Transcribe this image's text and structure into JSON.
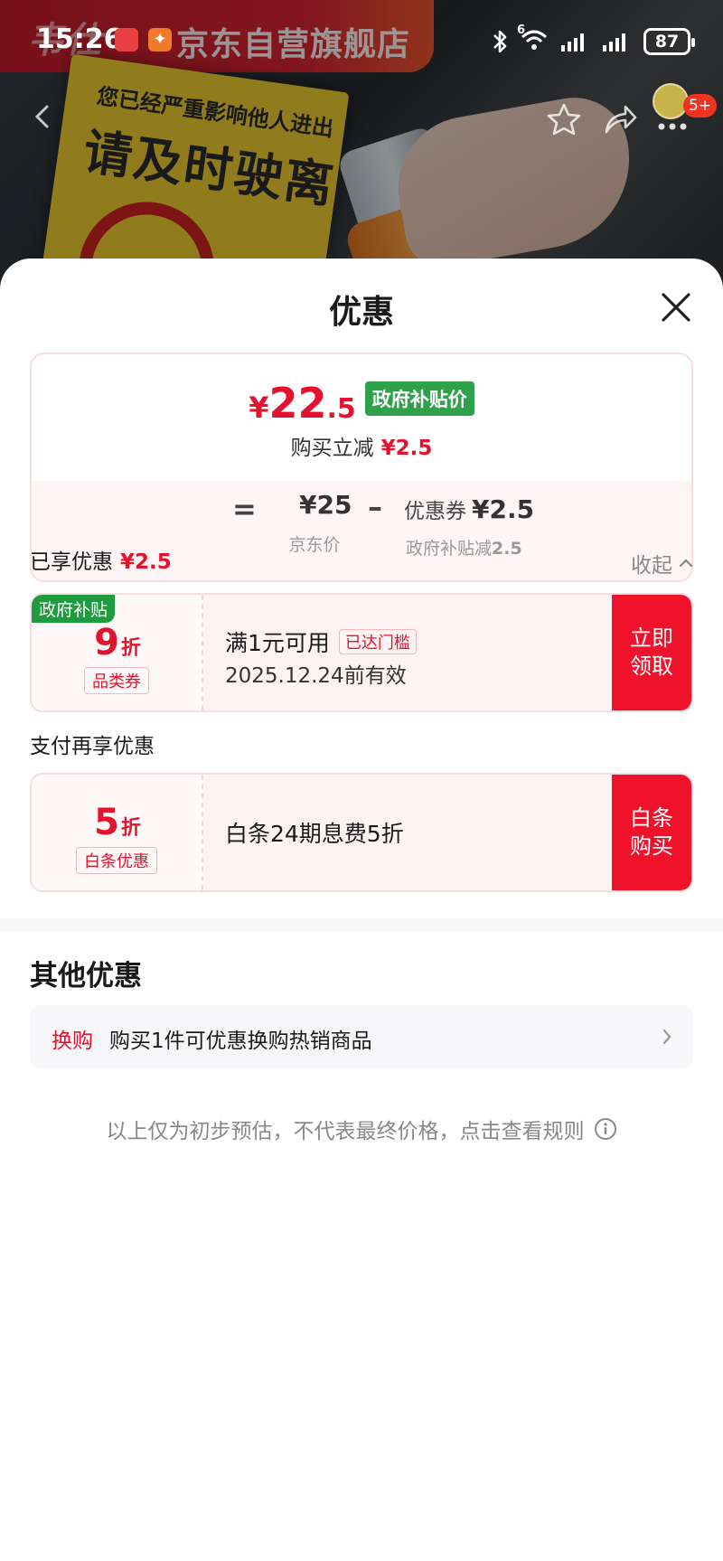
{
  "status_bar": {
    "time": "15:26",
    "battery": "87",
    "network": "6"
  },
  "hero": {
    "brand_logo_text": "韦仕",
    "shop_name": "京东自营旗舰店",
    "poster_line1": "您已经严重影响他人进出",
    "poster_line2": "请及时驶离",
    "message_badge": "5+"
  },
  "sheet": {
    "title": "优惠",
    "price_summary": {
      "currency": "¥",
      "final_int": "22",
      "final_dec": ".5",
      "gov_tag": "政府补贴价",
      "reduce_label": "购买立减",
      "reduce_amount": "¥2.5",
      "eq": "=",
      "jd_price": "¥25",
      "jd_label": "京东价",
      "minus": "–",
      "coupon_label": "优惠券",
      "coupon_value": "¥2.5",
      "coupon_sub_label": "政府补贴减",
      "coupon_sub_value": "2.5"
    },
    "enjoyed": {
      "label": "已享优惠",
      "amount": "¥2.5",
      "collapse_label": "收起"
    },
    "coupon1": {
      "corner_tag": "政府补贴",
      "discount_num": "9",
      "discount_unit": "折",
      "kind": "品类券",
      "condition": "满1元可用",
      "reached": "已达门槛",
      "expire": "2025.12.24前有效",
      "cta_line1": "立即",
      "cta_line2": "领取"
    },
    "pay_title": "支付再享优惠",
    "coupon2": {
      "discount_num": "5",
      "discount_unit": "折",
      "kind": "白条优惠",
      "desc": "白条24期息费5折",
      "cta_line1": "白条",
      "cta_line2": "购买"
    },
    "other": {
      "title": "其他优惠",
      "swap_tag": "换购",
      "swap_text": "购买1件可优惠换购热销商品"
    },
    "disclaimer": "以上仅为初步预估，不代表最终价格，点击查看规则"
  },
  "colors": {
    "accent_red": "#e4132d",
    "cta_red": "#f0112b",
    "gov_green": "#2ea14a"
  },
  "icons": [
    "back-icon",
    "star-icon",
    "share-icon",
    "more-icon",
    "close-icon",
    "chevron-up-icon",
    "chevron-right-icon",
    "info-icon",
    "bluetooth-icon",
    "wifi-icon",
    "signal-icon"
  ]
}
